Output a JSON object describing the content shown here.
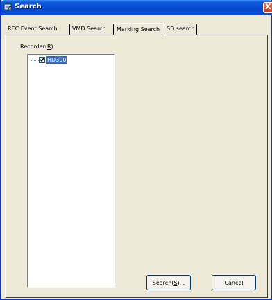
{
  "window": {
    "title": "Search",
    "close_glyph": "X",
    "title_icon": "search-window-icon"
  },
  "tabs": [
    {
      "label": "REC Event Search",
      "active": false
    },
    {
      "label": "VMD Search",
      "active": false
    },
    {
      "label": "Marking Search",
      "active": true
    },
    {
      "label": "SD search",
      "active": false
    }
  ],
  "recorder": {
    "label_prefix": "Recorder(",
    "label_hotkey": "R",
    "label_suffix": "):",
    "items": [
      {
        "label": "HD300",
        "checked": true,
        "selected": true
      }
    ]
  },
  "buttons": {
    "search_prefix": "Search(",
    "search_hotkey": "S",
    "search_suffix": ")...",
    "cancel": "Cancel"
  },
  "colors": {
    "titlebar": "#0648d0",
    "close": "#c3401d",
    "selection": "#316ac5",
    "face": "#ece9d8"
  }
}
